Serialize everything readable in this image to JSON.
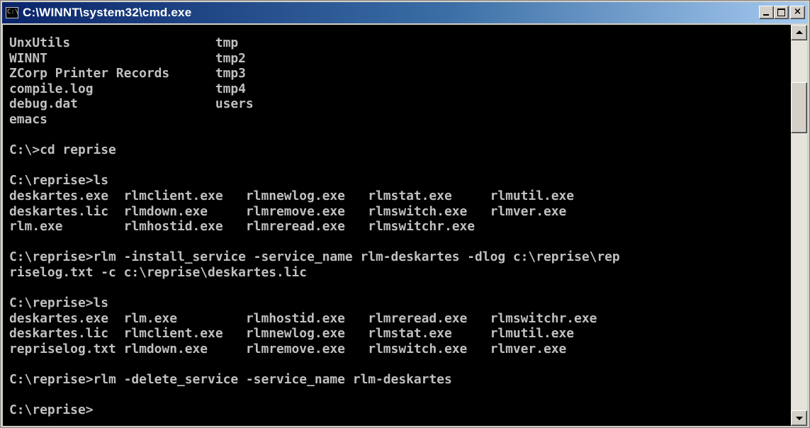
{
  "window": {
    "title": "C:\\WINNT\\system32\\cmd.exe",
    "icon": "cmd-icon",
    "icon_text": "C:\\",
    "buttons": {
      "minimize": "minimize-icon",
      "maximize": "maximize-icon",
      "close": "close-icon",
      "close_glyph": "×"
    }
  },
  "console": {
    "lines": [
      "UnxUtils                   tmp",
      "WINNT                      tmp2",
      "ZCorp Printer Records      tmp3",
      "compile.log                tmp4",
      "debug.dat                  users",
      "emacs",
      "",
      "C:\\>cd reprise",
      "",
      "C:\\reprise>ls",
      "deskartes.exe  rlmclient.exe   rlmnewlog.exe   rlmstat.exe     rlmutil.exe",
      "deskartes.lic  rlmdown.exe     rlmremove.exe   rlmswitch.exe   rlmver.exe",
      "rlm.exe        rlmhostid.exe   rlmreread.exe   rlmswitchr.exe",
      "",
      "C:\\reprise>rlm -install_service -service_name rlm-deskartes -dlog c:\\reprise\\rep",
      "riselog.txt -c c:\\reprise\\deskartes.lic",
      "",
      "C:\\reprise>ls",
      "deskartes.exe  rlm.exe         rlmhostid.exe   rlmreread.exe   rlmswitchr.exe",
      "deskartes.lic  rlmclient.exe   rlmnewlog.exe   rlmstat.exe     rlmutil.exe",
      "repriselog.txt rlmdown.exe     rlmremove.exe   rlmswitch.exe   rlmver.exe",
      "",
      "C:\\reprise>rlm -delete_service -service_name rlm-deskartes",
      "",
      "C:\\reprise>"
    ]
  },
  "scrollbar": {
    "up_icon": "scroll-up-arrow-icon",
    "down_icon": "scroll-down-arrow-icon",
    "position_fraction": 0.13
  },
  "colors": {
    "console_bg": "#000000",
    "console_fg": "#c0c0c0",
    "title_gradient_start": "#0a246a",
    "title_gradient_end": "#a6caf0"
  }
}
